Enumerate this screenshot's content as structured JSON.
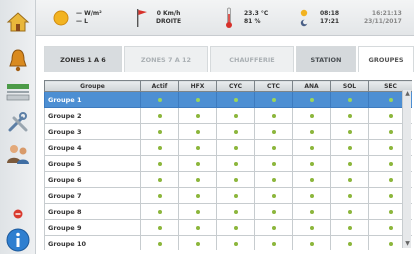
{
  "topbar": {
    "solar_value": "— W/m²",
    "solar_sub": "— L",
    "wind_speed": "0 Km/h",
    "wind_dir": "DROITE",
    "temp": "23.3 °C",
    "humidity": "81 %",
    "sunrise": "08:18",
    "sunset": "17:21",
    "time": "16:21:13",
    "date": "23/11/2017"
  },
  "tabs": [
    {
      "label": "ZONES 1 A 6"
    },
    {
      "label": "ZONES 7 A 12"
    },
    {
      "label": "CHAUFFERIE"
    },
    {
      "label": "STATION"
    },
    {
      "label": "GROUPES"
    }
  ],
  "table": {
    "columns": [
      "Groupe",
      "Actif",
      "HFX",
      "CYC",
      "CTC",
      "ANA",
      "SOL",
      "SEC"
    ],
    "rows": [
      {
        "name": "Groupe 1"
      },
      {
        "name": "Groupe 2"
      },
      {
        "name": "Groupe 3"
      },
      {
        "name": "Groupe 4"
      },
      {
        "name": "Groupe 5"
      },
      {
        "name": "Groupe 6"
      },
      {
        "name": "Groupe 7"
      },
      {
        "name": "Groupe 8"
      },
      {
        "name": "Groupe 9"
      },
      {
        "name": "Groupe 10"
      }
    ],
    "selected_row": "Groupe 1"
  },
  "colors": {
    "selected_row": "#4d8fd3",
    "led_on": "#8cb63c"
  },
  "sidebar_icons": [
    "home-icon",
    "bell-icon",
    "screen-icon",
    "tools-icon",
    "users-icon",
    "error-icon",
    "info-icon"
  ]
}
